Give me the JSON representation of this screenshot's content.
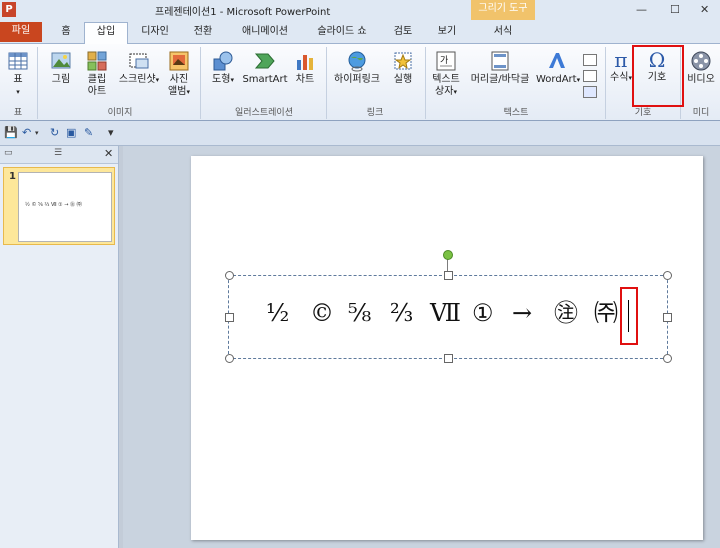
{
  "window": {
    "title": "프레젠테이션1 - Microsoft PowerPoint",
    "context_header": "그리기 도구",
    "app_icon_letter": "P"
  },
  "tabs": [
    {
      "label": "파일"
    },
    {
      "label": "홈"
    },
    {
      "label": "삽입"
    },
    {
      "label": "디자인"
    },
    {
      "label": "전환"
    },
    {
      "label": "애니메이션"
    },
    {
      "label": "슬라이드 쇼"
    },
    {
      "label": "검토"
    },
    {
      "label": "보기"
    },
    {
      "label": "서식"
    }
  ],
  "ribbon": {
    "table": {
      "label": "표",
      "group": "표"
    },
    "images": {
      "picture": "그림",
      "clipart_1": "클립",
      "clipart_2": "아트",
      "screenshot": "스크린샷",
      "photo_1": "사진",
      "photo_2": "앨범",
      "group": "이미지"
    },
    "illustrations": {
      "shapes": "도형",
      "smartart": "SmartArt",
      "chart": "차트",
      "group": "일러스트레이션"
    },
    "links": {
      "hyperlink": "하이퍼링크",
      "action": "실행",
      "group": "링크"
    },
    "text": {
      "textbox_1": "텍스트",
      "textbox_2": "상자",
      "header_footer": "머리글/바닥글",
      "wordart": "WordArt",
      "group": "텍스트"
    },
    "symbols": {
      "equation": "수식",
      "symbol": "기호",
      "group": "기호"
    },
    "media": {
      "video": "비디오",
      "group": "미디"
    }
  },
  "slide_panel": {
    "slide_number": "1"
  },
  "slide": {
    "symbols": [
      "½",
      "©",
      "⅝",
      "⅔",
      "Ⅶ",
      "①",
      "→",
      "㉟",
      "㈜"
    ],
    "symbol_display": [
      "½",
      "©",
      "⅝",
      "⅔",
      "Ⅶ",
      "①",
      "→",
      "㊟",
      "㈜"
    ]
  },
  "colors": {
    "accent_file_tab": "#c9461f",
    "highlight_red": "#e01010",
    "context_header": "#f1c36b"
  }
}
